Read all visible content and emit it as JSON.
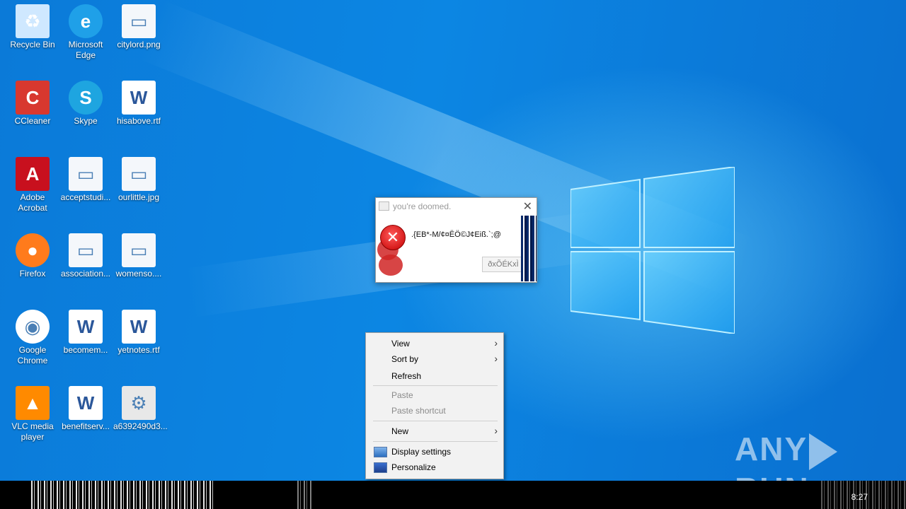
{
  "desktop": {
    "icons": [
      {
        "label": "Recycle Bin",
        "icon": "recycle-bin-icon"
      },
      {
        "label": "Microsoft Edge",
        "icon": "edge-icon"
      },
      {
        "label": "citylord.png",
        "icon": "image-file-icon"
      },
      {
        "label": "CCleaner",
        "icon": "ccleaner-icon"
      },
      {
        "label": "Skype",
        "icon": "skype-icon"
      },
      {
        "label": "hisabove.rtf",
        "icon": "word-document-icon"
      },
      {
        "label": "Adobe Acrobat",
        "icon": "acrobat-icon"
      },
      {
        "label": "acceptstudi...",
        "icon": "image-file-icon"
      },
      {
        "label": "ourlittle.jpg",
        "icon": "image-file-icon"
      },
      {
        "label": "Firefox",
        "icon": "firefox-icon"
      },
      {
        "label": "association...",
        "icon": "image-file-icon"
      },
      {
        "label": "womenso....",
        "icon": "image-file-icon"
      },
      {
        "label": "Google Chrome",
        "icon": "chrome-icon"
      },
      {
        "label": "becomem...",
        "icon": "word-document-icon"
      },
      {
        "label": "yetnotes.rtf",
        "icon": "word-document-icon"
      },
      {
        "label": "VLC media player",
        "icon": "vlc-icon"
      },
      {
        "label": "benefitserv...",
        "icon": "word-document-icon"
      },
      {
        "label": "a6392490d3...",
        "icon": "executable-icon"
      }
    ]
  },
  "dialog": {
    "title": "you're doomed.",
    "message": ".{EB*-M/¢¤ËÖ©J¢Eiß.`;@",
    "button_label": "ðxÕÉKxÌ",
    "close_symbol": "✕",
    "error_symbol": "✕",
    "colors": {
      "error": "#d21f1f"
    }
  },
  "context_menu": {
    "items": [
      {
        "label": "View",
        "submenu": true,
        "enabled": true
      },
      {
        "label": "Sort by",
        "submenu": true,
        "enabled": true
      },
      {
        "label": "Refresh",
        "submenu": false,
        "enabled": true
      },
      {
        "label": "Paste",
        "submenu": false,
        "enabled": false
      },
      {
        "label": "Paste shortcut",
        "submenu": false,
        "enabled": false
      },
      {
        "label": "New",
        "submenu": true,
        "enabled": true
      },
      {
        "label": "Display settings",
        "submenu": false,
        "enabled": true,
        "icon": "display-settings-icon"
      },
      {
        "label": "Personalize",
        "submenu": false,
        "enabled": true,
        "icon": "personalize-icon"
      }
    ],
    "submenu_arrow": "›"
  },
  "taskbar": {
    "clock": "8:27"
  },
  "watermark": {
    "left": "ANY",
    "right": "RUN"
  },
  "colors": {
    "wallpaper": "#0a7fd6",
    "menu_bg": "#f2f2f2"
  }
}
